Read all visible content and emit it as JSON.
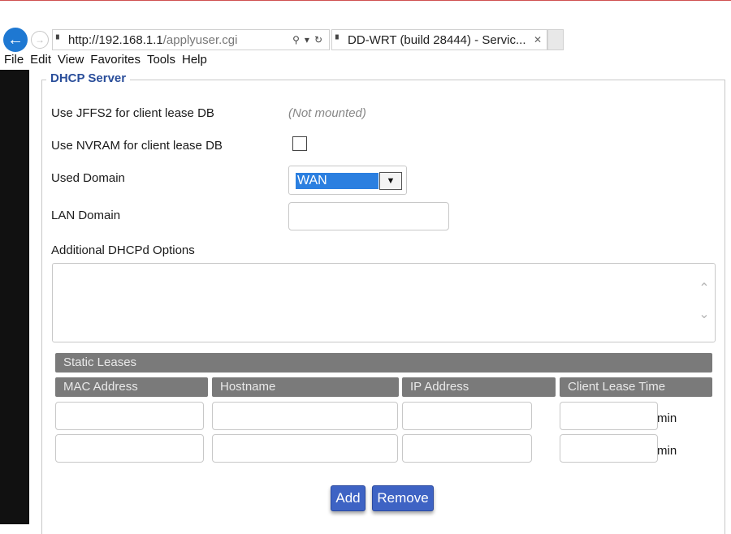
{
  "browser": {
    "address": {
      "scheme_host": "http://192.168.1.1",
      "path": "/applyuser.cgi"
    },
    "tab": {
      "title": "DD-WRT (build 28444) - Servic..."
    },
    "menu": [
      "File",
      "Edit",
      "View",
      "Favorites",
      "Tools",
      "Help"
    ]
  },
  "section": {
    "title": "DHCP Server",
    "jffs2": {
      "label": "Use JFFS2 for client lease DB",
      "value": "(Not mounted)"
    },
    "nvram": {
      "label": "Use NVRAM for client lease DB",
      "checked": false
    },
    "used_domain": {
      "label": "Used Domain",
      "selected": "WAN"
    },
    "lan_domain": {
      "label": "LAN Domain",
      "value": ""
    },
    "dhcpd_options": {
      "label": "Additional DHCPd Options",
      "value": ""
    }
  },
  "static_leases": {
    "title": "Static Leases",
    "columns": [
      "MAC Address",
      "Hostname",
      "IP Address",
      "Client Lease Time"
    ],
    "unit": "min",
    "rows": [
      {
        "mac": "",
        "hostname": "",
        "ip": "",
        "lease_time": ""
      },
      {
        "mac": "",
        "hostname": "",
        "ip": "",
        "lease_time": ""
      }
    ]
  },
  "buttons": {
    "add": "Add",
    "remove": "Remove"
  },
  "colors": {
    "accent": "#3e63c4",
    "legend": "#2a4e9a",
    "header_bg": "#7a7a7a",
    "select_highlight": "#2b7fe0"
  }
}
